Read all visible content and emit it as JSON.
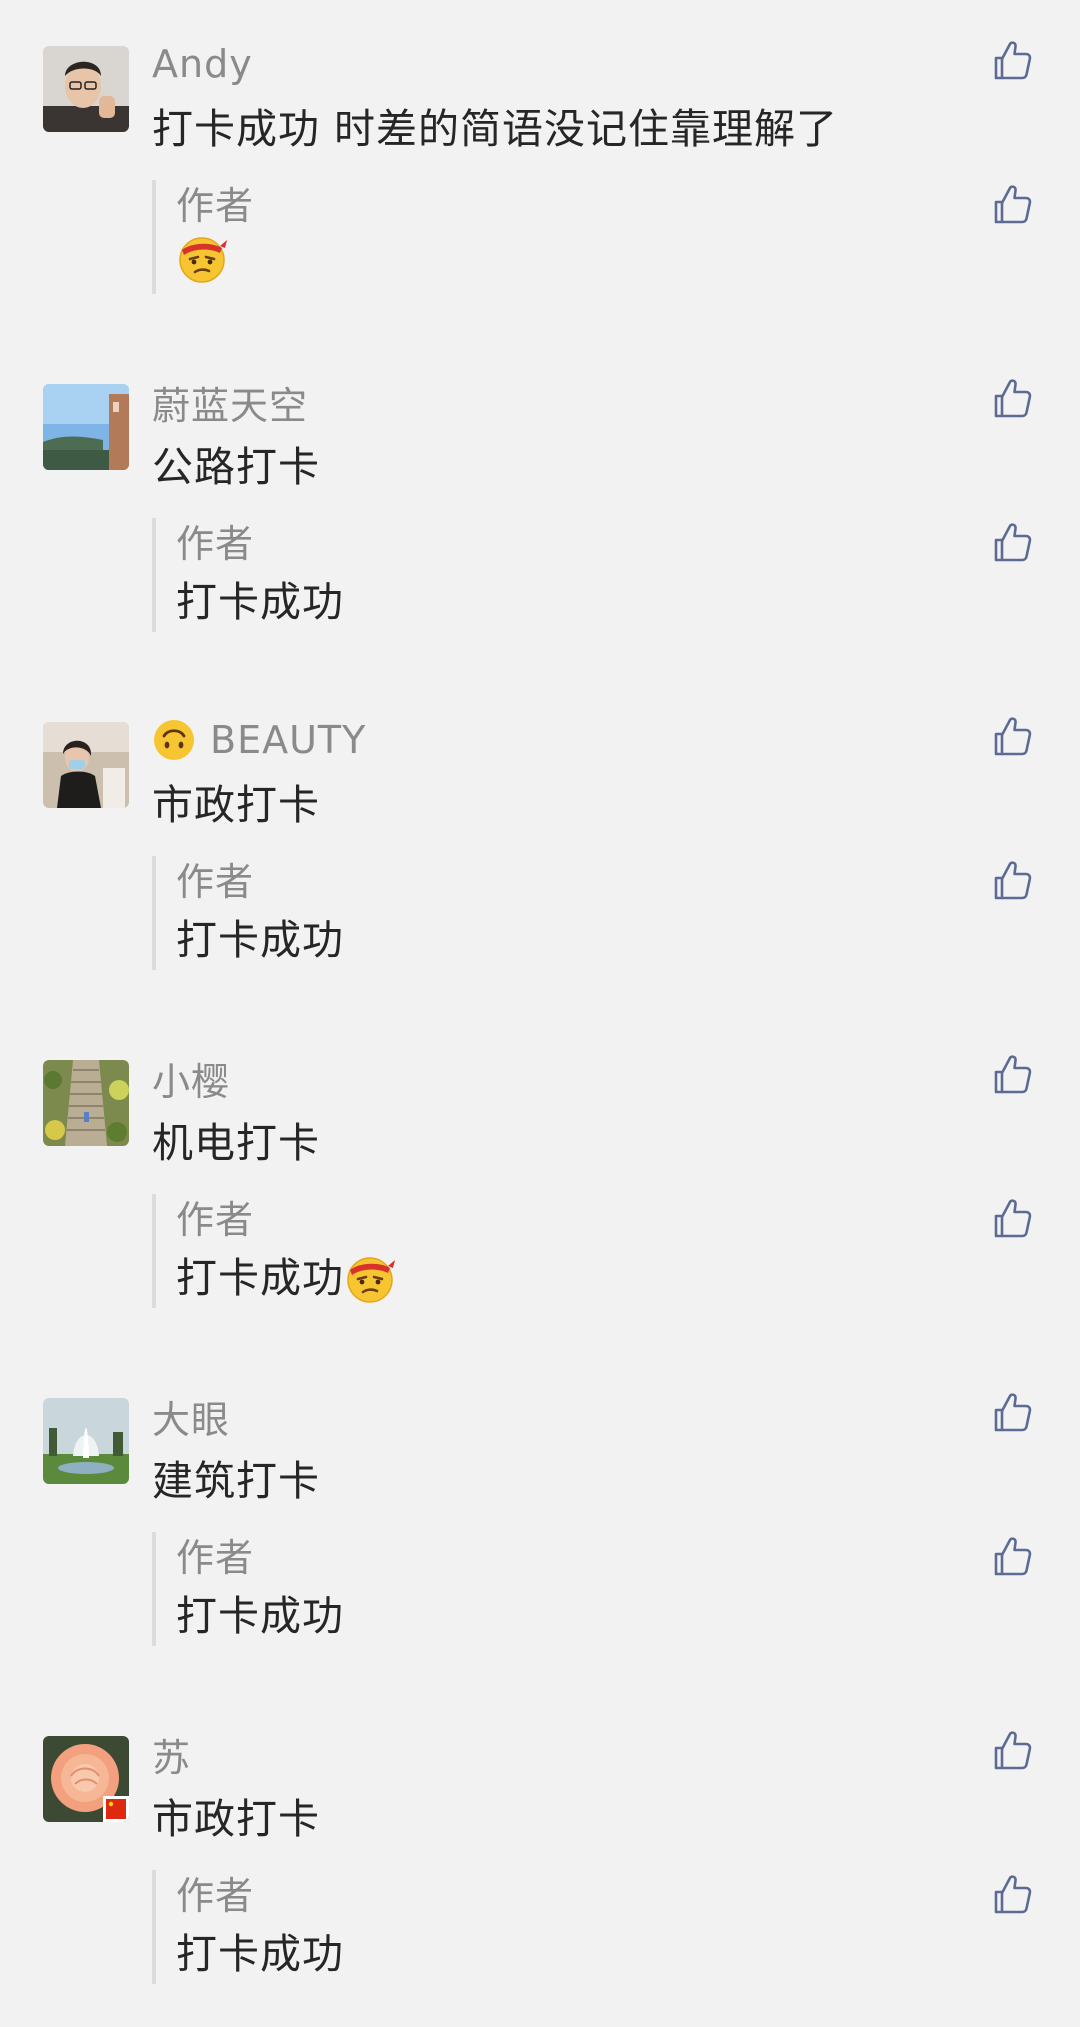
{
  "comments": [
    {
      "nickname": "Andy",
      "nickname_emoji": "",
      "avatar": "man-portrait-avatar",
      "content": "打卡成功 时差的简语没记住靠理解了",
      "reply": {
        "author": "作者",
        "text": "",
        "emoji": "grumpy-ninja-emoji"
      }
    },
    {
      "nickname": "蔚蓝天空",
      "nickname_emoji": "",
      "avatar": "sky-landscape-avatar",
      "content": "公路打卡",
      "reply": {
        "author": "作者",
        "text": "打卡成功",
        "emoji": ""
      }
    },
    {
      "nickname": "BEAUTY",
      "nickname_emoji": "upside-down-face-emoji",
      "avatar": "woman-seated-avatar",
      "content": "市政打卡",
      "reply": {
        "author": "作者",
        "text": "打卡成功",
        "emoji": ""
      }
    },
    {
      "nickname": "小樱",
      "nickname_emoji": "",
      "avatar": "garden-stairs-avatar",
      "content": "机电打卡",
      "reply": {
        "author": "作者",
        "text": "打卡成功",
        "emoji": "grumpy-ninja-emoji"
      }
    },
    {
      "nickname": "大眼",
      "nickname_emoji": "",
      "avatar": "fountain-avatar",
      "content": "建筑打卡",
      "reply": {
        "author": "作者",
        "text": "打卡成功",
        "emoji": ""
      }
    },
    {
      "nickname": "苏",
      "nickname_emoji": "",
      "avatar": "rose-flower-avatar",
      "content": "市政打卡",
      "reply": {
        "author": "作者",
        "text": "打卡成功",
        "emoji": ""
      }
    }
  ],
  "colors": {
    "background": "#f2f2f2",
    "nickname": "#8a8a8a",
    "content": "#262626",
    "like_icon": "#5d6b94",
    "reply_bar": "#dcdcdc"
  },
  "icons": {
    "like": "thumbs-up-icon"
  }
}
